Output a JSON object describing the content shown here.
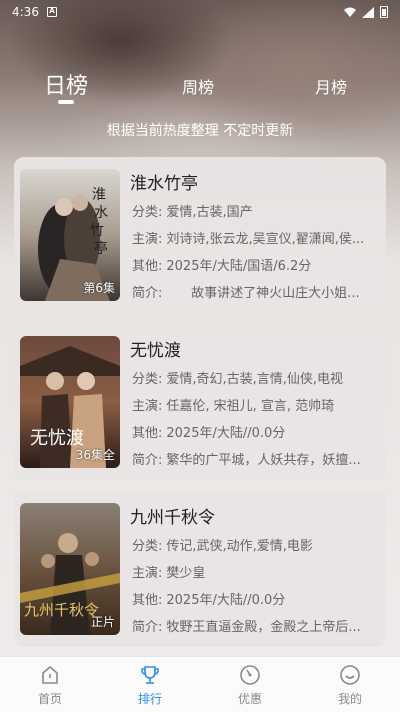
{
  "status_bar": {
    "time": "4:36"
  },
  "tabs": [
    {
      "label": "日榜",
      "active": true
    },
    {
      "label": "周榜",
      "active": false
    },
    {
      "label": "月榜",
      "active": false
    }
  ],
  "subtitle": "根据当前热度整理 不定时更新",
  "labels": {
    "category": "分类:",
    "cast": "主演:",
    "other": "其他:",
    "intro": "简介:"
  },
  "items": [
    {
      "title": "淮水竹亭",
      "badge": "第6集",
      "category": "爱情,古装,国产",
      "cast": "刘诗诗,张云龙,吴宣仪,翟潇闻,侯...",
      "other": "2025年/大陆/国语/6.2分",
      "intro": "      故事讲述了神火山庄大小姐..."
    },
    {
      "title": "无忧渡",
      "badge": "36集全",
      "category": "爱情,奇幻,古装,言情,仙侠,电视",
      "cast": "任嘉伦, 宋祖儿, 宣言, 范帅琦",
      "other": "2025年/大陆//0.0分",
      "intro": "繁华的广平城，人妖共存，妖擅..."
    },
    {
      "title": "九州千秋令",
      "badge": "正片",
      "category": "传记,武侠,动作,爱情,电影",
      "cast": "樊少皇",
      "other": "2025年/大陆//0.0分",
      "intro": "牧野王直逼金殿，金殿之上帝后..."
    }
  ],
  "nav": [
    {
      "label": "首页",
      "icon": "home-icon",
      "active": false
    },
    {
      "label": "排行",
      "icon": "trophy-icon",
      "active": true
    },
    {
      "label": "优惠",
      "icon": "discount-icon",
      "active": false
    },
    {
      "label": "我的",
      "icon": "profile-icon",
      "active": false
    }
  ],
  "colors": {
    "accent": "#2b8dea",
    "inactive": "#8a8a8a"
  }
}
